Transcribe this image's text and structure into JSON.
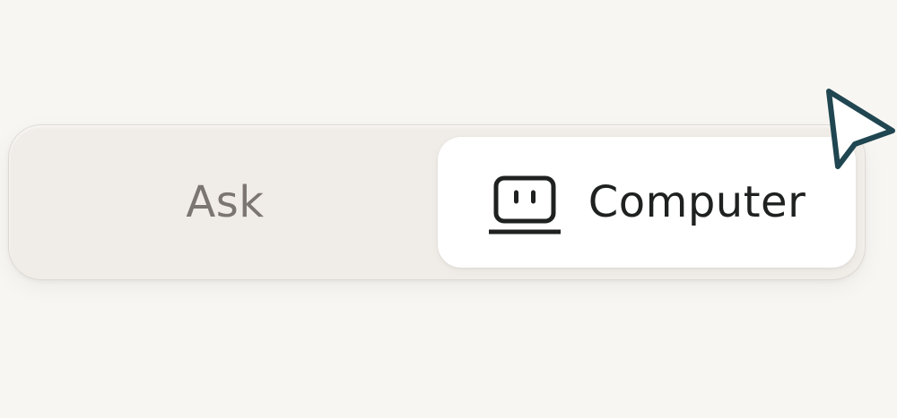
{
  "mode_toggle": {
    "segments": [
      {
        "id": "ask",
        "label": "Ask",
        "selected": false
      },
      {
        "id": "computer",
        "label": "Computer",
        "icon": "computer-icon",
        "selected": true
      }
    ]
  },
  "colors": {
    "background": "#f8f6f3",
    "toggle_track": "#f0ece7",
    "selected_segment": "#ffffff",
    "unselected_text": "#7b7672",
    "selected_text": "#1f2020",
    "cursor_outline": "#1f4651"
  }
}
